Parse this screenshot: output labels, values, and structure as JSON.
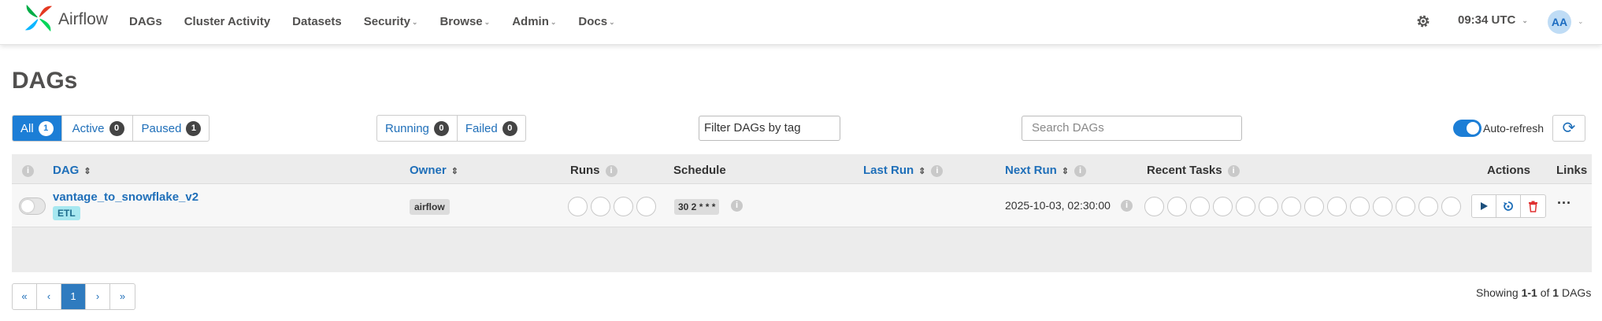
{
  "brand": {
    "name": "Airflow"
  },
  "nav": {
    "items": [
      {
        "label": "DAGs",
        "caret": false
      },
      {
        "label": "Cluster Activity",
        "caret": false
      },
      {
        "label": "Datasets",
        "caret": false
      },
      {
        "label": "Security",
        "caret": true
      },
      {
        "label": "Browse",
        "caret": true
      },
      {
        "label": "Admin",
        "caret": true
      },
      {
        "label": "Docs",
        "caret": true
      }
    ],
    "time": "09:34 UTC",
    "avatar": "AA"
  },
  "page": {
    "title": "DAGs"
  },
  "filters": {
    "all": {
      "label": "All",
      "count": "1"
    },
    "active": {
      "label": "Active",
      "count": "0"
    },
    "paused": {
      "label": "Paused",
      "count": "1"
    },
    "running": {
      "label": "Running",
      "count": "0"
    },
    "failed": {
      "label": "Failed",
      "count": "0"
    },
    "tag_placeholder": "Filter DAGs by tag",
    "search_placeholder": "Search DAGs",
    "auto_refresh_label": "Auto-refresh"
  },
  "table": {
    "headers": {
      "dag": "DAG",
      "owner": "Owner",
      "runs": "Runs",
      "schedule": "Schedule",
      "last_run": "Last Run",
      "next_run": "Next Run",
      "recent_tasks": "Recent Tasks",
      "actions": "Actions",
      "links": "Links"
    },
    "rows": [
      {
        "dag_id": "vantage_to_snowflake_v2",
        "tag": "ETL",
        "owner": "airflow",
        "schedule": "30 2 * * *",
        "last_run": "",
        "next_run": "2025-10-03, 02:30:00",
        "paused": true
      }
    ]
  },
  "pagination": {
    "first": "«",
    "prev": "‹",
    "current": "1",
    "next": "›",
    "last": "»"
  },
  "footer": {
    "showing_prefix": "Showing",
    "range": "1-1",
    "of": "of",
    "total": "1",
    "suffix": "DAGs"
  },
  "colors": {
    "accent": "#1c7ed6",
    "link": "#1f6fb9",
    "tag_bg": "#a7e8f0",
    "delete": "#e03131"
  }
}
